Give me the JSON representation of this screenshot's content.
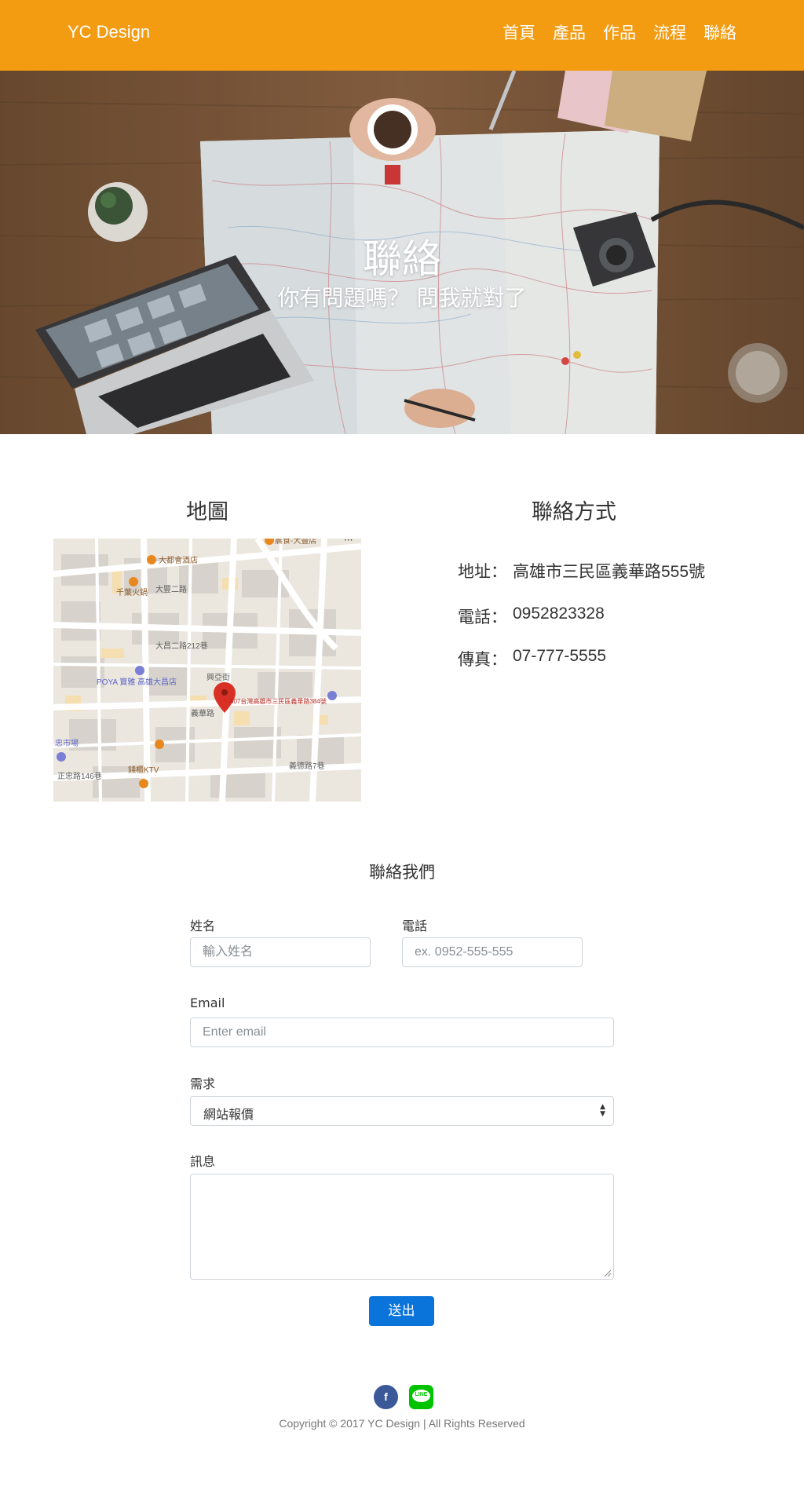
{
  "navbar": {
    "brand": "YC Design",
    "links": [
      "首頁",
      "產品",
      "作品",
      "流程",
      "聯絡"
    ],
    "color": "#f39c12"
  },
  "hero": {
    "title": "聯絡",
    "subtitle": "你有問題嗎？ 問我就對了"
  },
  "map_section": {
    "title": "地圖",
    "map_labels": [
      "大都會酒店",
      "千葉火鍋",
      "大豐二路",
      "大昌二路212巷",
      "POYA 寶雅 高雄大昌店",
      "807台灣高雄市三民區義華路384號",
      "義華路",
      "興亞街",
      "錢櫃KTV",
      "忠市場",
      "正忠路146巷",
      "義德路7巷",
      "晨食-大豐店"
    ]
  },
  "contact_section": {
    "title": "聯絡方式",
    "items": [
      {
        "key": "地址：",
        "value": "高雄市三民區義華路555號"
      },
      {
        "key": "電話：",
        "value": "0952823328"
      },
      {
        "key": "傳真：",
        "value": "07-777-5555"
      }
    ]
  },
  "form": {
    "title": "聯絡我們",
    "name_label": "姓名",
    "name_placeholder": "輸入姓名",
    "phone_label": "電話",
    "phone_placeholder": "ex. 0952-555-555",
    "email_label": "Email",
    "email_placeholder": "Enter email",
    "need_label": "需求",
    "need_value": "網站報價",
    "message_label": "訊息",
    "submit_label": "送出",
    "submit_color": "#0a74da"
  },
  "footer": {
    "facebook_icon": "f",
    "line_icon": "LINE",
    "copyright": "Copyright © 2017 YC Design | All Rights Reserved"
  }
}
